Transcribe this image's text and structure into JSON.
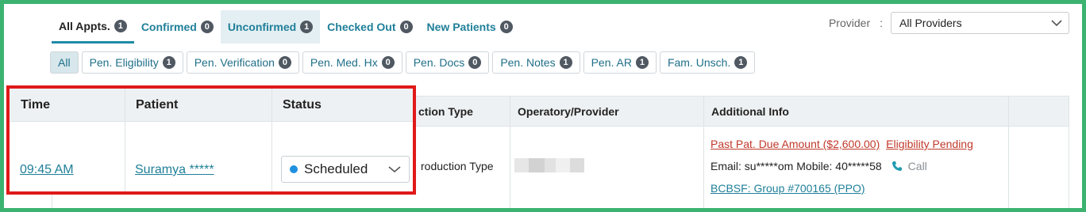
{
  "tabs": [
    {
      "label": "All Appts.",
      "count": "1"
    },
    {
      "label": "Confirmed",
      "count": "0"
    },
    {
      "label": "Unconfirmed",
      "count": "1"
    },
    {
      "label": "Checked Out",
      "count": "0"
    },
    {
      "label": "New Patients",
      "count": "0"
    }
  ],
  "provider": {
    "label": "Provider",
    "colon": ":",
    "selected": "All Providers"
  },
  "filters": [
    {
      "label": "All"
    },
    {
      "label": "Pen. Eligibility",
      "count": "1"
    },
    {
      "label": "Pen. Verification",
      "count": "0"
    },
    {
      "label": "Pen. Med. Hx",
      "count": "0"
    },
    {
      "label": "Pen. Docs",
      "count": "0"
    },
    {
      "label": "Pen. Notes",
      "count": "1"
    },
    {
      "label": "Pen. AR",
      "count": "1"
    },
    {
      "label": "Fam. Unsch.",
      "count": "1"
    }
  ],
  "table": {
    "headers": {
      "production_type": "ction Type",
      "operatory": "Operatory/Provider",
      "additional": "Additional Info"
    },
    "row": {
      "production_type": "roduction Type",
      "past_due": "Past Pat. Due Amount ($2,600.00)",
      "eligibility": "Eligibility Pending",
      "email": "Email: su*****om",
      "mobile": "Mobile: 40*****58",
      "call": "Call",
      "insurance": "BCBSF: Group #700165 (PPO)"
    }
  },
  "highlight": {
    "headers": {
      "time": "Time",
      "patient": "Patient",
      "status": "Status"
    },
    "time": "09:45 AM",
    "patient": "Suramya *****",
    "status": "Scheduled"
  },
  "colors": {
    "accent": "#1f7f99",
    "highlight_border": "#e01919",
    "status_dot": "#1e90e0",
    "frame": "#3cb371"
  }
}
